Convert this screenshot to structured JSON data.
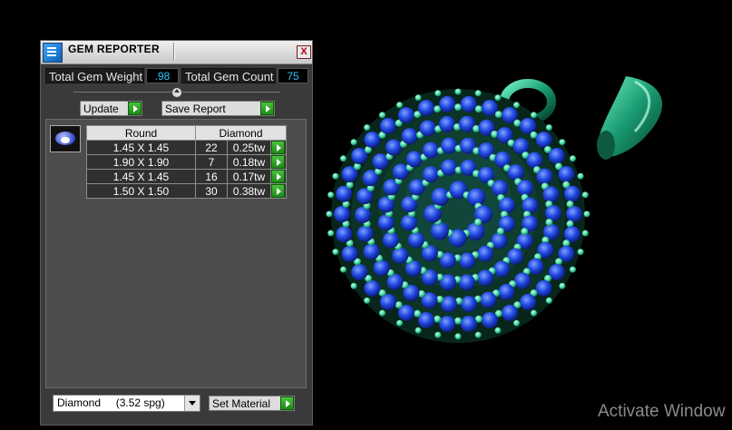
{
  "panel": {
    "title": "GEM REPORTER",
    "close_label": "X",
    "total_weight_label": "Total Gem Weight",
    "total_weight_value": ".98",
    "total_count_label": "Total Gem Count",
    "total_count_value": "75",
    "update_label": "Update",
    "save_report_label": "Save Report"
  },
  "table": {
    "headers": [
      "Round",
      "Diamond"
    ],
    "rows": [
      {
        "size": "1.45 X 1.45",
        "count": "22",
        "weight": "0.25tw"
      },
      {
        "size": "1.90 X 1.90",
        "count": "7",
        "weight": "0.18tw"
      },
      {
        "size": "1.45 X 1.45",
        "count": "16",
        "weight": "0.17tw"
      },
      {
        "size": "1.50 X 1.50",
        "count": "30",
        "weight": "0.38tw"
      }
    ]
  },
  "material": {
    "selected": "Diamond     (3.52 spg)",
    "set_label": "Set Material"
  },
  "watermark": "Activate Window",
  "colors": {
    "value_text": "#2fc4ff",
    "gem_blue": "#1f46e0",
    "prong_green": "#3fd6a0",
    "metal_green": "#1a9a72"
  },
  "icons": [
    "gem-reporter-icon",
    "close-icon",
    "slider-knob-icon",
    "play-arrow-icon",
    "gem-thumbnail-icon",
    "dropdown-arrow-icon"
  ]
}
